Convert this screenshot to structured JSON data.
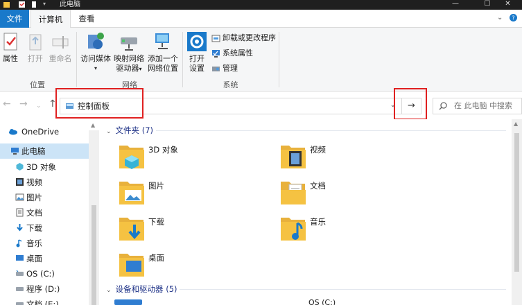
{
  "window": {
    "title": "此电脑",
    "controls": [
      "—",
      "☐",
      "✕"
    ]
  },
  "tabs": {
    "file": "文件",
    "computer": "计算机",
    "view": "查看"
  },
  "ribbon": {
    "location": {
      "label": "位置",
      "properties": "属性",
      "open": "打开",
      "rename": "重命名"
    },
    "network": {
      "label": "网络",
      "access_media_1": "访问媒体",
      "map_drive_1": "映射网络",
      "map_drive_2": "驱动器",
      "add_location_1": "添加一个",
      "add_location_2": "网络位置"
    },
    "system": {
      "label": "系统",
      "open_settings_1": "打开",
      "open_settings_2": "设置",
      "uninstall": "卸载或更改程序",
      "system_properties": "系统属性",
      "manage": "管理"
    }
  },
  "address": {
    "path": "控制面板",
    "go_arrow": "→",
    "search_placeholder": "在 此电脑 中搜索"
  },
  "nav": {
    "items": [
      {
        "label": "OneDrive",
        "icon": "cloud-icon"
      },
      {
        "label": "此电脑",
        "icon": "computer-icon"
      },
      {
        "label": "3D 对象",
        "icon": "cube-icon"
      },
      {
        "label": "视频",
        "icon": "video-icon"
      },
      {
        "label": "图片",
        "icon": "picture-icon"
      },
      {
        "label": "文档",
        "icon": "document-icon"
      },
      {
        "label": "下载",
        "icon": "download-icon"
      },
      {
        "label": "音乐",
        "icon": "music-icon"
      },
      {
        "label": "桌面",
        "icon": "desktop-icon"
      },
      {
        "label": "OS (C:)",
        "icon": "drive-icon"
      },
      {
        "label": "程序 (D:)",
        "icon": "drive-icon"
      },
      {
        "label": "文档 (E:)",
        "icon": "drive-icon"
      }
    ]
  },
  "main": {
    "folders_header": "文件夹 (7)",
    "folders": [
      {
        "label": "3D 对象",
        "icon": "3d-objects-folder-icon"
      },
      {
        "label": "视频",
        "icon": "videos-folder-icon"
      },
      {
        "label": "图片",
        "icon": "pictures-folder-icon"
      },
      {
        "label": "文档",
        "icon": "documents-folder-icon"
      },
      {
        "label": "下载",
        "icon": "downloads-folder-icon"
      },
      {
        "label": "音乐",
        "icon": "music-folder-icon"
      },
      {
        "label": "桌面",
        "icon": "desktop-folder-icon"
      }
    ],
    "devices_header": "设备和驱动器 (5)",
    "devices_partial": [
      "OS (C:)"
    ]
  },
  "colors": {
    "accent": "#1979ca",
    "highlight": "#e02020",
    "selection": "#cce4f7",
    "folder_yellow": "#f5c242"
  }
}
